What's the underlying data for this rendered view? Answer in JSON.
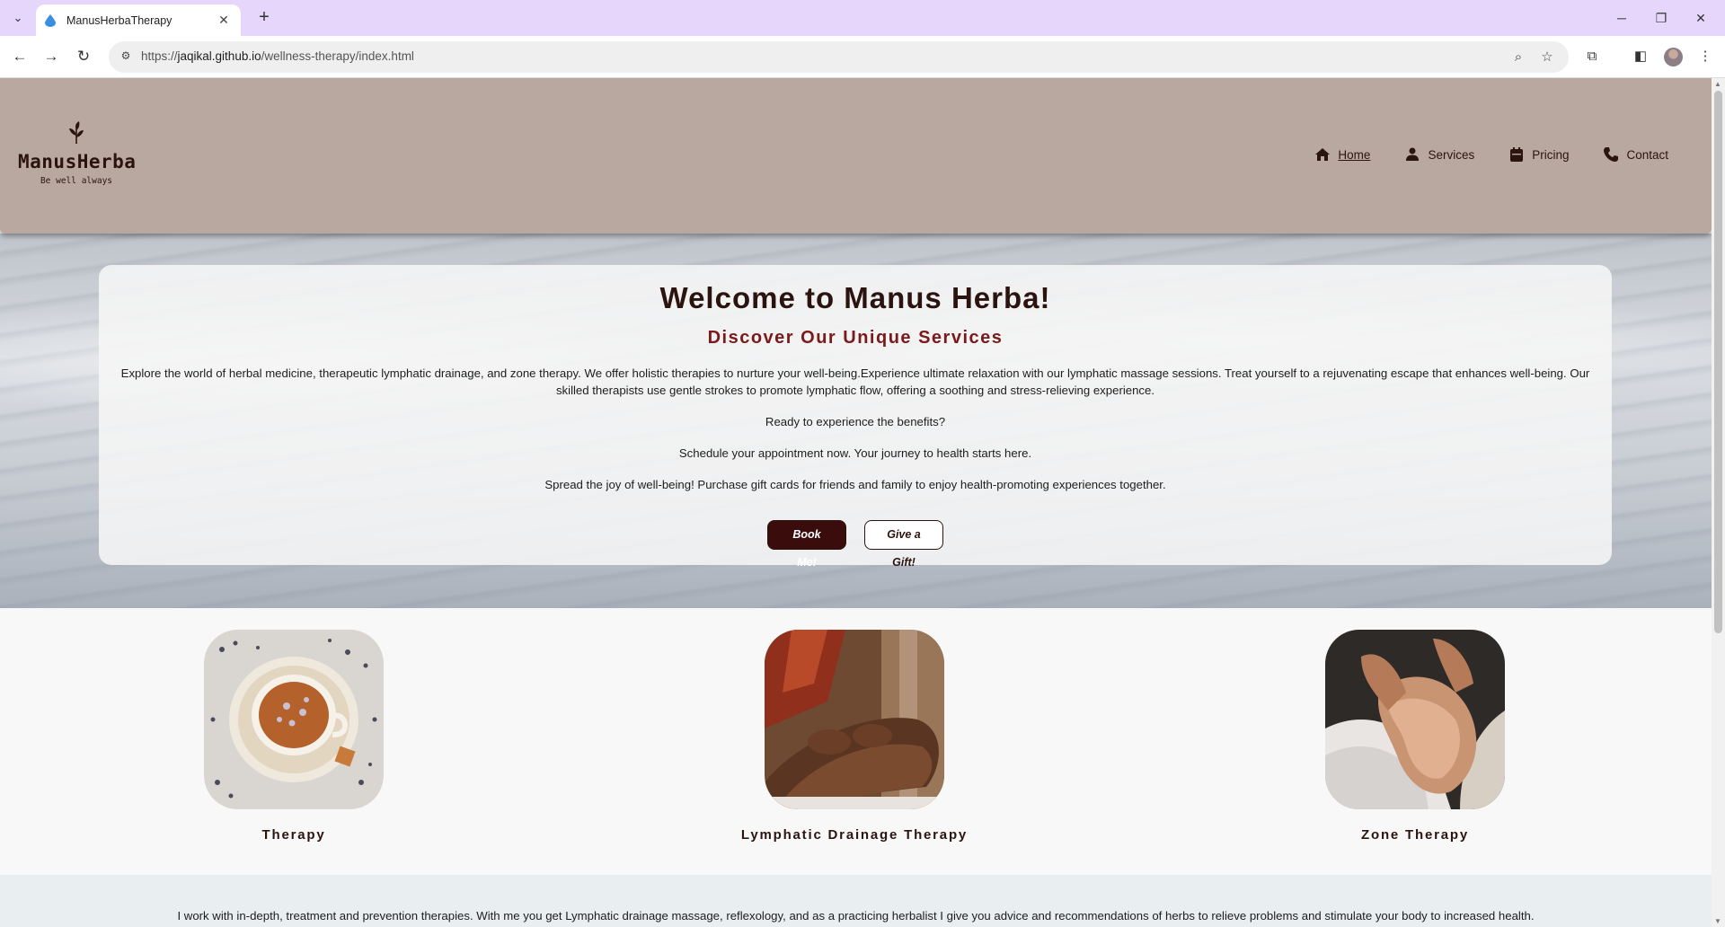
{
  "browser": {
    "tab_title": "ManusHerbaTherapy",
    "url_prefix": "https://",
    "url_host": "jaqikal.github.io",
    "url_path": "/wellness-therapy/index.html"
  },
  "header": {
    "logo_name": "ManusHerba",
    "logo_tagline": "Be well always",
    "nav": [
      {
        "label": "Home",
        "icon": "home-icon",
        "active": true
      },
      {
        "label": "Services",
        "icon": "person-icon",
        "active": false
      },
      {
        "label": "Pricing",
        "icon": "calendar-icon",
        "active": false
      },
      {
        "label": "Contact",
        "icon": "phone-icon",
        "active": false
      }
    ]
  },
  "hero": {
    "title": "Welcome to Manus Herba!",
    "subtitle": "Discover Our Unique Services",
    "paragraph": "Explore the world of herbal medicine, therapeutic lymphatic drainage, and zone therapy. We offer holistic therapies to nurture your well-being.Experience ultimate relaxation with our lymphatic massage sessions. Treat yourself to a rejuvenating escape that enhances well-being. Our skilled therapists use gentle strokes to promote lymphatic flow, offering a soothing and stress-relieving experience.",
    "line_ready": "Ready to experience the benefits?",
    "line_schedule": "Schedule your appointment now. Your journey to health starts here.",
    "line_gift": "Spread the joy of well-being! Purchase gift cards for friends and family to enjoy health-promoting experiences together.",
    "book_button": "Book Me!",
    "gift_button": "Give a Gift!"
  },
  "services": [
    {
      "label": "Therapy",
      "image": "herbal-tea-image"
    },
    {
      "label": "Lymphatic Drainage Therapy",
      "image": "leg-massage-image"
    },
    {
      "label": "Zone Therapy",
      "image": "foot-reflexology-image"
    }
  ],
  "intro": {
    "text": "I work with in-depth, treatment and prevention therapies. With me you get Lymphatic drainage massage, reflexology, and as a practicing herbalist I give you advice and recommendations of herbs to relieve problems and stimulate your body to increased health."
  },
  "colors": {
    "header_bg": "#b9a8a0",
    "brand_dark": "#2b1410",
    "subtitle_red": "#7a1a1a",
    "button_dark": "#3a0c0c",
    "tabbar_bg": "#e6d6fb"
  }
}
